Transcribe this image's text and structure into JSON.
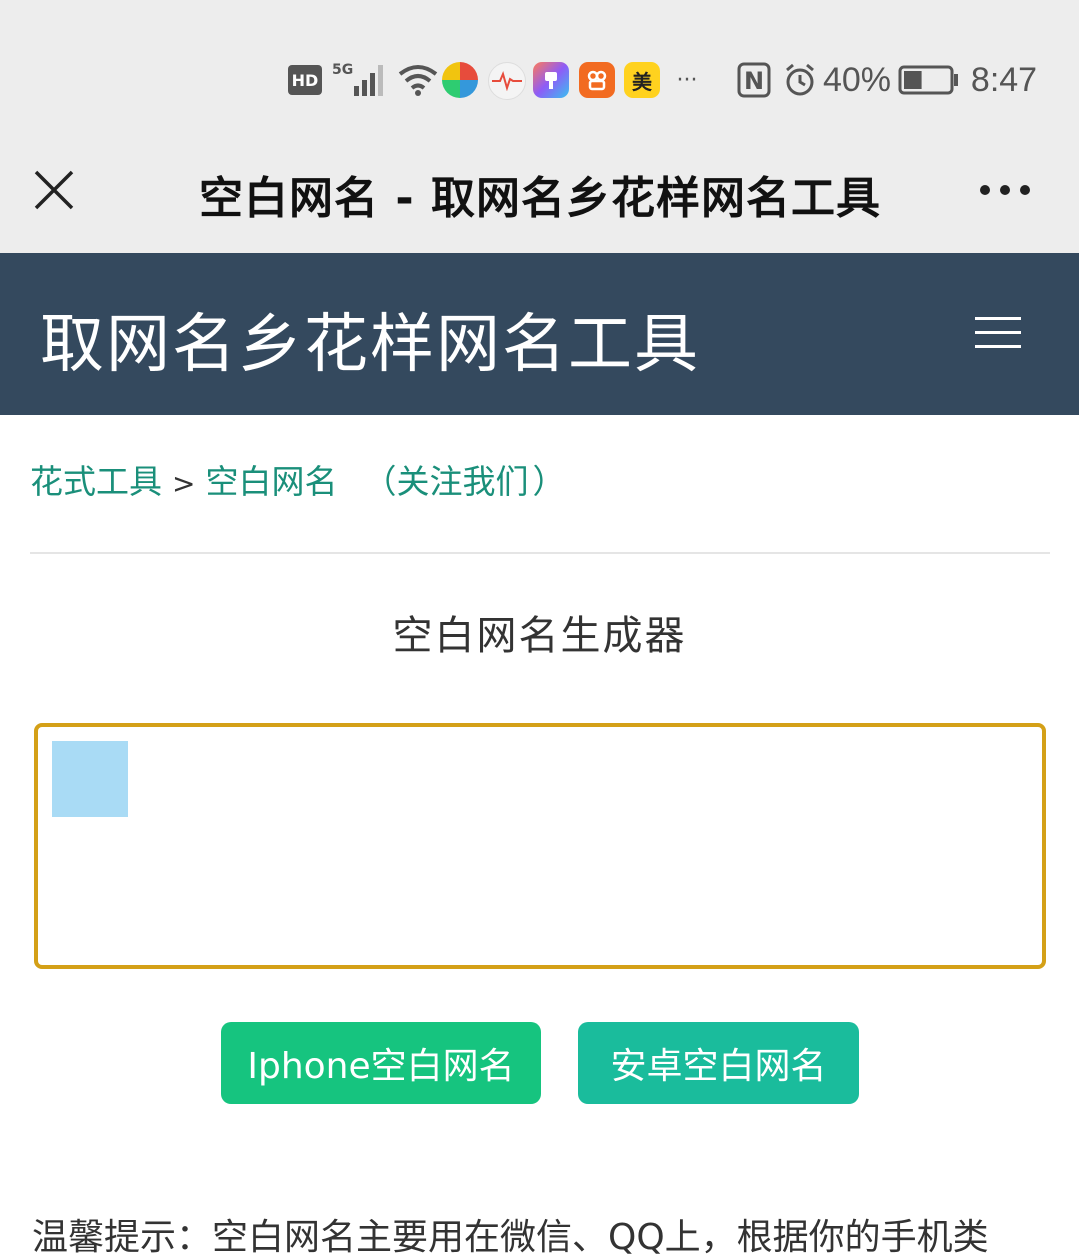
{
  "status_bar": {
    "network_badge": "HD",
    "cellular_label": "5G",
    "app_icon_5_label": "美",
    "more_notifications": "···",
    "nfc_label": "N",
    "battery_percent": "40%",
    "battery_level": 0.4,
    "time": "8:47"
  },
  "webview": {
    "title": "空白网名 - 取网名乡花样网名工具"
  },
  "site_header": {
    "title": "取网名乡花样网名工具"
  },
  "breadcrumb": {
    "root": "花式工具",
    "separator": ">",
    "current": "空白网名",
    "follow_open": "（",
    "follow_link": "关注我们",
    "follow_close": "）"
  },
  "generator": {
    "title": "空白网名生成器",
    "textarea_value": ""
  },
  "buttons": {
    "iphone": "Iphone空白网名",
    "android": "安卓空白网名"
  },
  "tips": {
    "text": "温馨提示：空白网名主要用在微信、QQ上，根据你的手机类"
  },
  "colors": {
    "header_bg": "#34495e",
    "link": "#1a8f7a",
    "textarea_border": "#d4a017",
    "btn_iphone": "#16c47f",
    "btn_android": "#1abc9c",
    "selection": "#a9dbf5"
  }
}
